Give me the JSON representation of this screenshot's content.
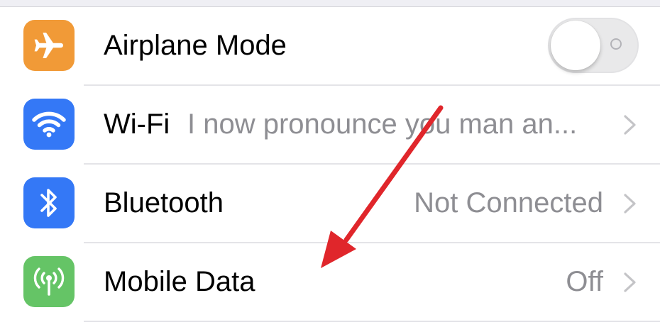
{
  "colors": {
    "airplane_icon_bg": "#f19a37",
    "wifi_icon_bg": "#3478f6",
    "bluetooth_icon_bg": "#3478f6",
    "mobile_data_icon_bg": "#65c466",
    "annotation_arrow": "#e0262b",
    "secondary_text": "#8e8e93"
  },
  "settings": {
    "airplane": {
      "icon": "airplane-icon",
      "label": "Airplane Mode",
      "toggle_on": false
    },
    "wifi": {
      "icon": "wifi-icon",
      "label": "Wi-Fi",
      "value": "I now pronounce you man an..."
    },
    "bluetooth": {
      "icon": "bluetooth-icon",
      "label": "Bluetooth",
      "value": "Not Connected"
    },
    "mobile_data": {
      "icon": "antenna-icon",
      "label": "Mobile Data",
      "value": "Off"
    }
  },
  "annotation": {
    "icon": "red-arrow-annotation",
    "points_to": "Mobile Data"
  }
}
